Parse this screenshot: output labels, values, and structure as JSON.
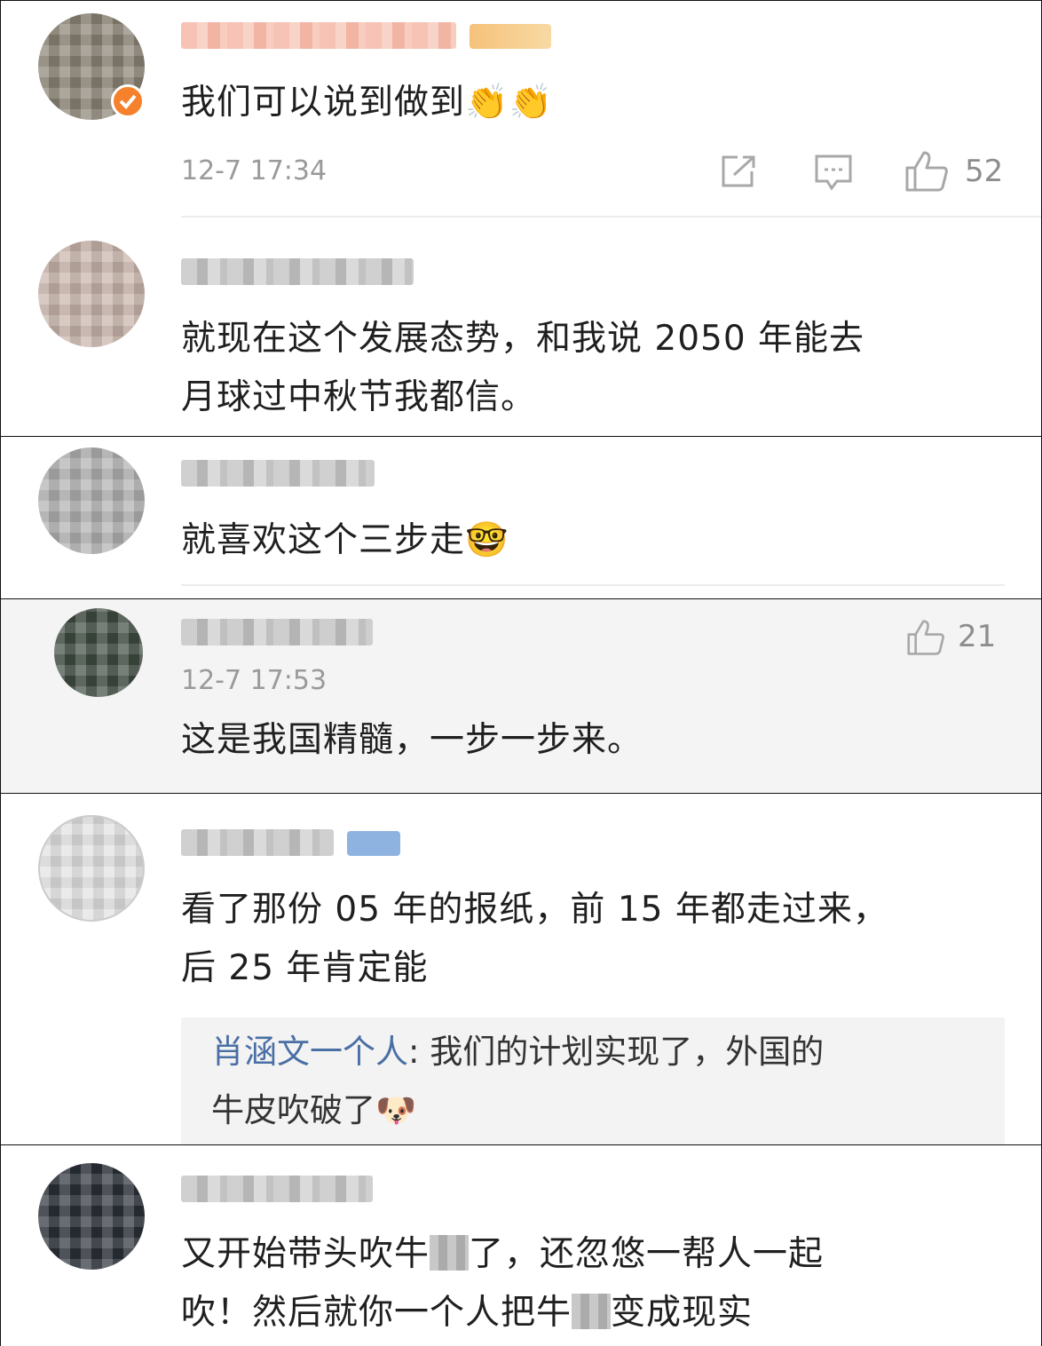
{
  "comments": [
    {
      "text": "我们可以说到做到👏👏",
      "time": "12-7 17:34",
      "likes": "52"
    },
    {
      "text_line1": "就现在这个发展态势，和我说 2050 年能去",
      "text_line2": "月球过中秋节我都信。"
    },
    {
      "text": "就喜欢这个三步走🤓"
    },
    {
      "time": "12-7 17:53",
      "likes": "21",
      "text": "这是我国精髓，一步一步来。"
    },
    {
      "text_line1": "看了那份 05 年的报纸，前 15 年都走过来，",
      "text_line2": "后 25 年肯定能",
      "reply_name": "肖涵文一个人",
      "reply_sep": ": ",
      "reply_line1": "我们的计划实现了，外国的",
      "reply_line2": "牛皮吹破了🐶"
    },
    {
      "line1_a": "又开始带头吹牛",
      "line1_b": "了，还忽悠一帮人一起",
      "line2_a": "吹！然后就你一个人把牛",
      "line2_b": "变成现实"
    }
  ],
  "icons": [
    "share-icon",
    "comment-icon",
    "like-icon"
  ],
  "colors": {
    "reply_name": "#4a6fa5",
    "meta": "#9a9a9a"
  }
}
